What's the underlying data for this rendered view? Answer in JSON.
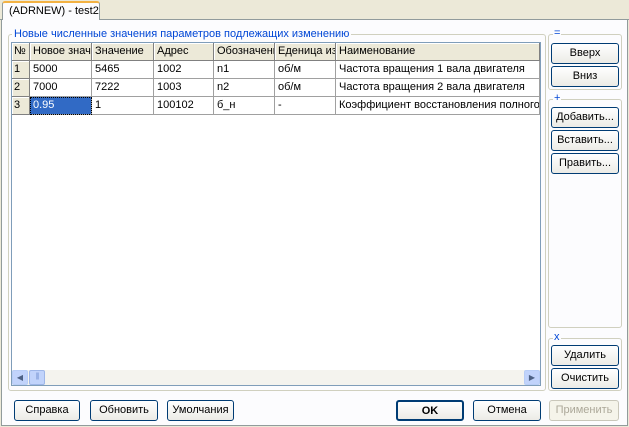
{
  "window": {
    "tab_title": "(ADRNEW) - test2"
  },
  "main_group": {
    "title": "Новые численные значения параметров подлежащих изменению"
  },
  "table": {
    "columns": [
      "№",
      "Новое значение",
      "Значение",
      "Адрес",
      "Обозначение",
      "Еденица измерения",
      "Наименование"
    ],
    "rows": [
      [
        "1",
        "5000",
        "5465",
        "1002",
        "n1",
        "об/м",
        "Частота вращения 1 вала двигателя"
      ],
      [
        "2",
        "7000",
        "7222",
        "1003",
        "n2",
        "об/м",
        "Частота вращения 2 вала двигателя"
      ],
      [
        "3",
        "0.95",
        "1",
        "100102",
        "б_н",
        "-",
        "Коэффициент восстановления полного д"
      ]
    ]
  },
  "move_group": {
    "label": "=",
    "up": "Вверх",
    "down": "Вниз"
  },
  "add_group": {
    "label": "+",
    "add": "Добавить...",
    "insert": "Вставить...",
    "edit": "Править..."
  },
  "remove_group": {
    "label": "x",
    "delete": "Удалить",
    "clear": "Очистить"
  },
  "footer": {
    "help": "Справка",
    "refresh": "Обновить",
    "defaults": "Умолчания",
    "ok": "OK",
    "cancel": "Отмена",
    "apply": "Применить"
  }
}
